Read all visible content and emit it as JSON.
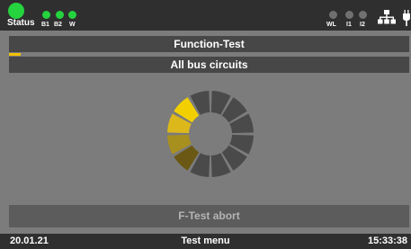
{
  "status_bar": {
    "status_label": "Status",
    "indicators_left": [
      {
        "label": "B1",
        "state": "on"
      },
      {
        "label": "B2",
        "state": "on"
      },
      {
        "label": "W",
        "state": "on"
      }
    ],
    "indicators_right": [
      {
        "label": "WL",
        "state": "off"
      },
      {
        "label": "I1",
        "state": "off"
      },
      {
        "label": "I2",
        "state": "off"
      }
    ],
    "icons": [
      "network-icon",
      "plug-icon"
    ]
  },
  "header": {
    "title": "Function-Test",
    "subtitle": "All bus circuits"
  },
  "progress": {
    "value": 0.03
  },
  "spinner": {
    "segments": 12,
    "colors": [
      "#f2d000",
      "#dcb81a",
      "#a8901f",
      "#6b5814"
    ],
    "inactive_color": "#4a4a4a"
  },
  "actions": {
    "abort_label": "F-Test abort"
  },
  "footer": {
    "date": "20.01.21",
    "menu_label": "Test menu",
    "time": "15:33:38"
  },
  "colors": {
    "background": "#7c7c7c",
    "bar": "#2f2f2f",
    "panel": "#474747",
    "led_on": "#24d33e",
    "led_off": "#707070",
    "accent": "#f2c200"
  }
}
